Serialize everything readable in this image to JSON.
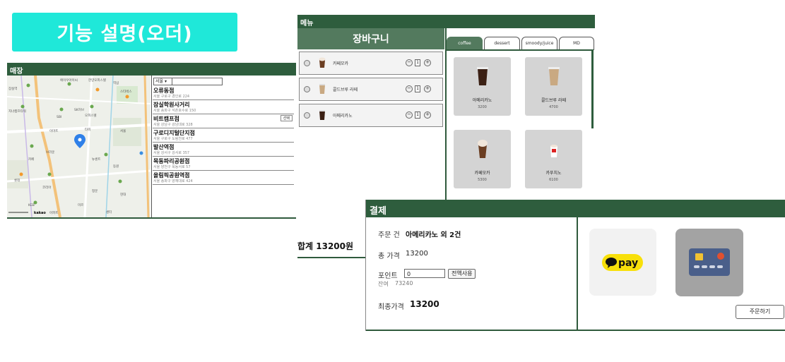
{
  "title_badge": "기능 설명(오더)",
  "store_panel": {
    "header": "매장",
    "region_select": "서울",
    "select_button": "선택",
    "stores": [
      {
        "name": "오류동점",
        "address": "서울 구로구 경인로 224"
      },
      {
        "name": "잠실학원사거리",
        "address": "서울 송파구 석촌호수로 150"
      },
      {
        "name": "비트캠프점",
        "address": "서울 강남구 강남대로 328"
      },
      {
        "name": "구로디지털단지점",
        "address": "서울 구로구 도림천로 477"
      },
      {
        "name": "발산역점",
        "address": "서울 강서구 강서로 357"
      },
      {
        "name": "목동파리공원점",
        "address": "서울 양천구 목동서로 57"
      },
      {
        "name": "올림픽공원역점",
        "address": "서울 송파구 양재대로 424"
      }
    ],
    "map_labels": [
      "잠실역",
      "에이우아이씨",
      "한양오피스텔",
      "지너캠프타워",
      "스타벅스",
      "SK허브",
      "오피스텔",
      "역삼",
      "SBI",
      "타워",
      "이마트",
      "서울",
      "카페",
      "브라운",
      "뉴센트",
      "동원",
      "롯데",
      "코리아",
      "정문",
      "현대",
      "KEB",
      "미르",
      "아파트",
      "센터"
    ],
    "map_scale": "kakao"
  },
  "menu_panel": {
    "header": "메뉴",
    "cart_title": "장바구니",
    "cart_items": [
      {
        "name": "카페모카",
        "qty": "1"
      },
      {
        "name": "콜드브루 라떼",
        "qty": "1"
      },
      {
        "name": "아메리카노",
        "qty": "1"
      }
    ],
    "total": "합계 13200원",
    "tabs": [
      "coffee",
      "dessert",
      "smoody/juice",
      "MD"
    ],
    "products": [
      {
        "name": "아메리카노",
        "price": "3200"
      },
      {
        "name": "콜드브루 라떼",
        "price": "4700"
      },
      {
        "name": "카페모카",
        "price": "5300"
      },
      {
        "name": "카푸치노",
        "price": "6100"
      }
    ]
  },
  "payment_panel": {
    "header": "결제",
    "order_label": "주문 건",
    "order_value": "아메리카노 외 2건",
    "total_label": "총 가격",
    "total_value": "13200",
    "point_label": "포인트",
    "point_value": "0",
    "use_all_button": "전액사용",
    "balance_label": "잔여",
    "balance_value": "73240",
    "final_label": "최종가격",
    "final_value": "13200",
    "kakaopay_text": "pay",
    "order_button": "주문하기"
  },
  "colors": {
    "brand_green": "#2e5d3d",
    "header_green": "#537a5e",
    "title_cyan": "#1fe8d9",
    "kakao_yellow": "#f8e00a"
  }
}
